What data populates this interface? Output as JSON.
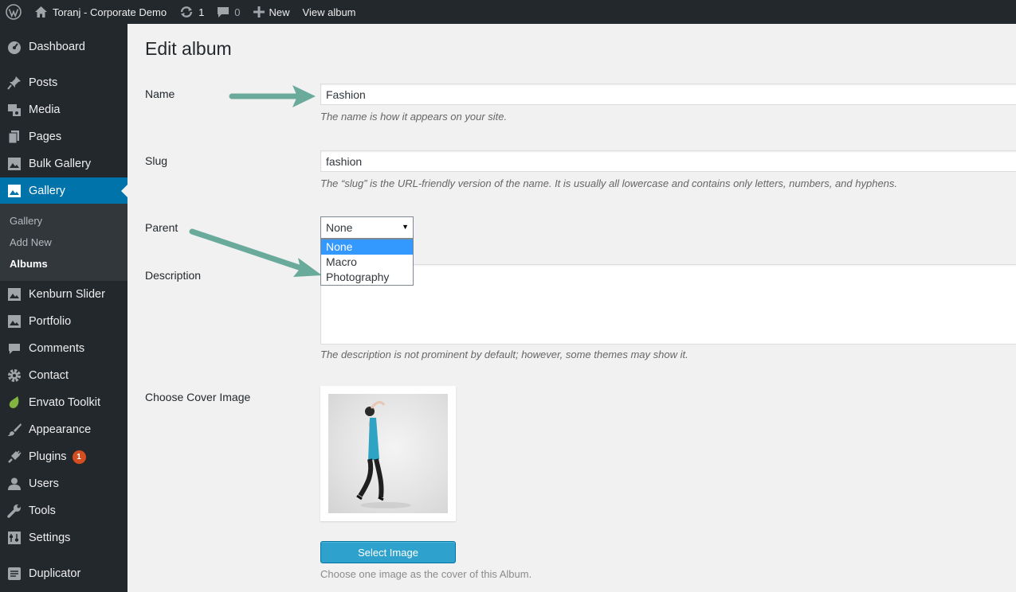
{
  "adminbar": {
    "icons": {
      "wp_logo": "wordpress-logo-icon",
      "home": "home-icon",
      "updates": "refresh-icon",
      "comments": "comment-bubble-icon",
      "new": "plus-icon"
    },
    "site_name": "Toranj - Corporate Demo",
    "updates_count": "1",
    "comments_count": "0",
    "new_label": "New",
    "view_label": "View album"
  },
  "sidebar": {
    "items": [
      {
        "label": "Dashboard",
        "icon": "dashboard-icon"
      },
      {
        "label": "Posts",
        "icon": "pin-icon"
      },
      {
        "label": "Media",
        "icon": "media-icon"
      },
      {
        "label": "Pages",
        "icon": "pages-icon"
      },
      {
        "label": "Bulk Gallery",
        "icon": "gallery-icon"
      },
      {
        "label": "Gallery",
        "icon": "gallery-icon"
      },
      {
        "label": "Kenburn Slider",
        "icon": "gallery-icon"
      },
      {
        "label": "Portfolio",
        "icon": "gallery-icon"
      },
      {
        "label": "Comments",
        "icon": "comment-icon"
      },
      {
        "label": "Contact",
        "icon": "gear-icon"
      },
      {
        "label": "Envato Toolkit",
        "icon": "leaf-icon"
      },
      {
        "label": "Appearance",
        "icon": "brush-icon"
      },
      {
        "label": "Plugins",
        "icon": "plug-icon",
        "badge": "1"
      },
      {
        "label": "Users",
        "icon": "user-icon"
      },
      {
        "label": "Tools",
        "icon": "wrench-icon"
      },
      {
        "label": "Settings",
        "icon": "settings-icon"
      },
      {
        "label": "Duplicator",
        "icon": "duplicator-icon"
      }
    ],
    "submenu": [
      "Gallery",
      "Add New",
      "Albums"
    ]
  },
  "colors": {
    "admin_dark": "#23282d",
    "submenu_bg": "#32373c",
    "accent": "#0073aa",
    "button": "#2ea2cc",
    "annotation_arrow": "#6aaa9a",
    "badge": "#d54e21"
  },
  "form": {
    "title": "Edit album",
    "name_label": "Name",
    "name_value": "Fashion",
    "name_desc": "The name is how it appears on your site.",
    "slug_label": "Slug",
    "slug_value": "fashion",
    "slug_desc": "The “slug” is the URL-friendly version of the name. It is usually all lowercase and contains only letters, numbers, and hyphens.",
    "parent_label": "Parent",
    "parent_selected": "None",
    "parent_options": [
      "None",
      "Macro",
      "Photography"
    ],
    "description_label": "Description",
    "description_value": "",
    "description_desc": "The description is not prominent by default; however, some themes may show it.",
    "cover_label": "Choose Cover Image",
    "select_image_label": "Select Image",
    "cover_desc": "Choose one image as the cover of this Album."
  }
}
